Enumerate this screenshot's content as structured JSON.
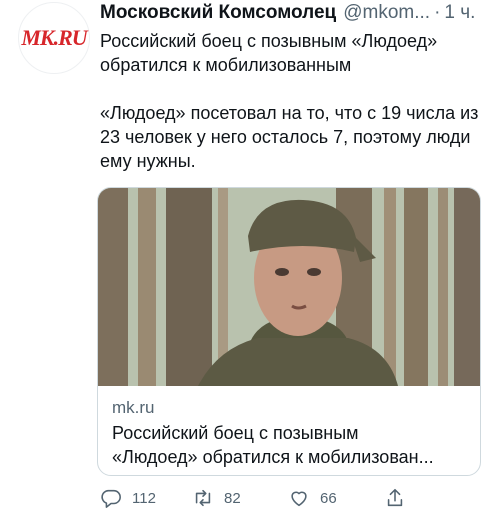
{
  "tweet": {
    "author_name": "Московский Комсомолец",
    "author_handle": "@mkom...",
    "separator": "·",
    "time": "1 ч.",
    "avatar_logo": "MK.RU",
    "text": "Российский боец с позывным «Людоед» обратился к мобилизованным\n\n«Людоед» посетовал на то, что с 19 числа из 23 человек у него осталось 7, поэтому люди ему нужны."
  },
  "card": {
    "domain": "mk.ru",
    "title_line1": "Российский боец с позывным",
    "title_line2": "«Людоед» обратился к мобилизован..."
  },
  "actions": {
    "replies": "112",
    "retweets": "82",
    "likes": "66"
  },
  "colors": {
    "text": "#0f1419",
    "secondary": "#536471",
    "border": "#cfd9de",
    "brand_red": "#d7262b"
  },
  "icons": [
    "reply-icon",
    "retweet-icon",
    "like-icon",
    "share-icon"
  ]
}
